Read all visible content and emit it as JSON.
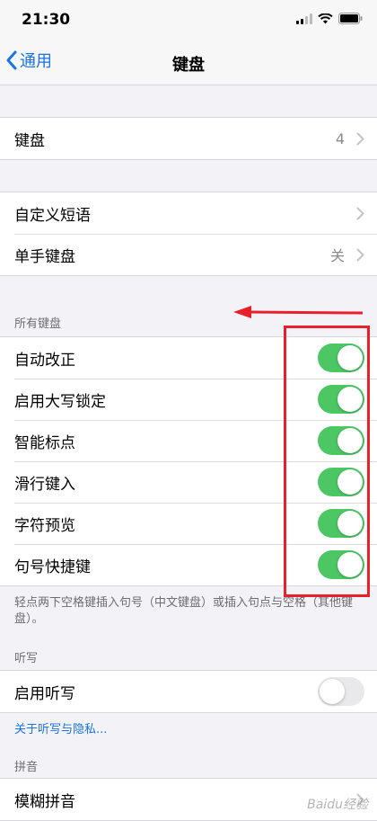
{
  "status_bar": {
    "time": "21:30"
  },
  "nav": {
    "back_label": "通用",
    "title": "键盘"
  },
  "group_keyboards": {
    "label": "键盘",
    "value": "4"
  },
  "group_text": {
    "items": [
      {
        "label": "自定义短语",
        "value": ""
      },
      {
        "label": "单手键盘",
        "value": "关"
      }
    ]
  },
  "all_keyboards": {
    "header": "所有键盘",
    "toggles": [
      {
        "label": "自动改正",
        "on": true
      },
      {
        "label": "启用大写锁定",
        "on": true
      },
      {
        "label": "智能标点",
        "on": true
      },
      {
        "label": "滑行键入",
        "on": true
      },
      {
        "label": "字符预览",
        "on": true
      },
      {
        "label": "句号快捷键",
        "on": true
      }
    ],
    "footer": "轻点两下空格键插入句号（中文键盘）或插入句点与空格（其他键盘）。"
  },
  "dictation": {
    "header": "听写",
    "label": "启用听写",
    "on": false,
    "link": "关于听写与隐私..."
  },
  "pinyin": {
    "header": "拼音",
    "label": "模糊拼音"
  },
  "colors": {
    "accent": "#1a73e8",
    "toggle_on": "#4cc764",
    "annotation": "#e8202a"
  },
  "watermark": "Baidu经验"
}
